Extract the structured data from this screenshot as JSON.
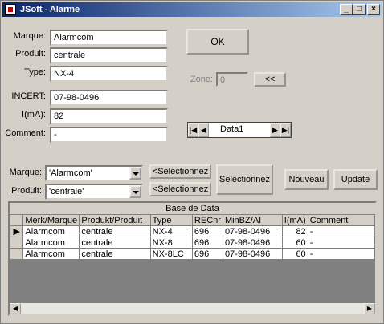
{
  "window": {
    "title": "JSoft - Alarme",
    "min": "_",
    "max": "□",
    "close": "×"
  },
  "form": {
    "marque_label": "Marque:",
    "marque_value": "Alarmcom",
    "produit_label": "Produit:",
    "produit_value": "centrale",
    "type_label": "Type:",
    "type_value": "NX-4",
    "incert_label": "INCERT:",
    "incert_value": "07-98-0496",
    "ima_label": "I(mA):",
    "ima_value": "82",
    "comment_label": "Comment:",
    "comment_value": "-"
  },
  "ok_button": "OK",
  "zone": {
    "label": "Zone:",
    "value": "0",
    "button": "<<"
  },
  "data_control": {
    "caption": "Data1",
    "first": "|◀",
    "prev": "◀",
    "next": "▶",
    "last": "▶|"
  },
  "filters": {
    "marque_label": "Marque:",
    "marque_value": "'Alarmcom'",
    "produit_label": "Produit:",
    "produit_value": "'centrale'",
    "select_marque_button": "<Selectionnez",
    "select_produit_button": "<Selectionnez",
    "select_button": "Selectionnez",
    "new_button": "Nouveau",
    "update_button": "Update"
  },
  "grid": {
    "caption": "Base de Data",
    "columns": [
      "Merk/Marque",
      "Produkt/Produit",
      "Type",
      "RECnr",
      "MinBZ/AI",
      "I(mA)",
      "Comment"
    ],
    "rows": [
      [
        "Alarmcom",
        "centrale",
        "NX-4",
        "696",
        "07-98-0496",
        "82",
        "-"
      ],
      [
        "Alarmcom",
        "centrale",
        "NX-8",
        "696",
        "07-98-0496",
        "60",
        "-"
      ],
      [
        "Alarmcom",
        "centrale",
        "NX-8LC",
        "696",
        "07-98-0496",
        "60",
        "-"
      ]
    ],
    "current_row_marker": "▶",
    "scroll_left": "◀",
    "scroll_right": "▶"
  }
}
